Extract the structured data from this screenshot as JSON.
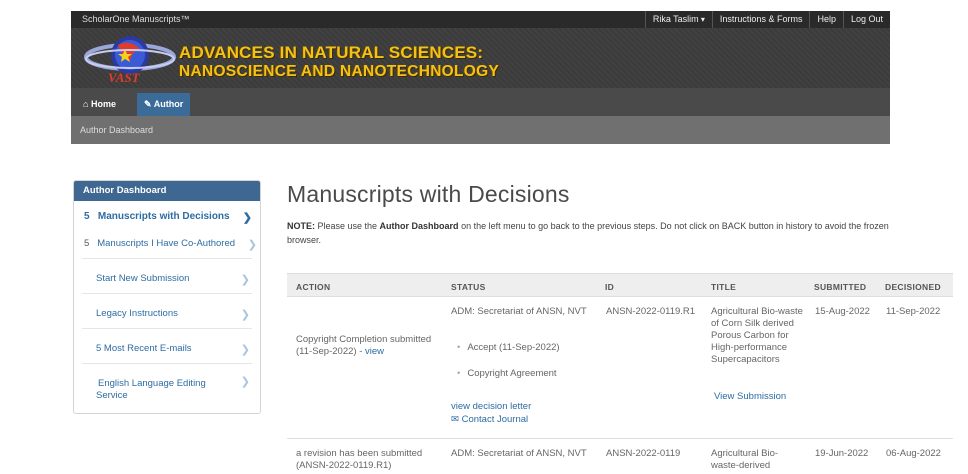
{
  "topbar": {
    "brand": "ScholarOne Manuscripts™",
    "user": "Rika Taslim",
    "instructions": "Instructions & Forms",
    "help": "Help",
    "logout": "Log Out"
  },
  "logo": {
    "text": "VAST"
  },
  "journal": {
    "line1": "ADVANCES IN NATURAL SCIENCES:",
    "line2": "NANOSCIENCE AND NANOTECHNOLOGY"
  },
  "nav": {
    "home": "Home",
    "author": "Author"
  },
  "breadcrumb": "Author Dashboard",
  "sidebar": {
    "header": "Author Dashboard",
    "items": [
      {
        "count": "5",
        "label": "Manuscripts with Decisions"
      },
      {
        "count": "5",
        "label": "Manuscripts I Have Co-Authored"
      },
      {
        "label": "Start New Submission"
      },
      {
        "label": "Legacy Instructions"
      },
      {
        "label": "5 Most Recent E-mails"
      },
      {
        "label": "English Language Editing Service"
      }
    ]
  },
  "page_title": "Manuscripts with Decisions",
  "note": {
    "prefix": "NOTE:",
    "text1": " Please use the ",
    "bold": "Author Dashboard",
    "text2": " on the left menu to go back to the previous steps. Do not click on BACK button in history to avoid the frozen browser."
  },
  "table": {
    "headers": [
      "ACTION",
      "STATUS",
      "ID",
      "TITLE",
      "SUBMITTED",
      "DECISIONED"
    ],
    "rows": [
      {
        "action": "Copyright Completion submitted (11-Sep-2022) - ",
        "action_link": "view",
        "status": "ADM: Secretariat of ANSN, NVT",
        "status_items": [
          "Accept (11-Sep-2022)",
          "Copyright Agreement"
        ],
        "decision_letter": "view decision letter",
        "contact": "Contact Journal",
        "id": "ANSN-2022-0119.R1",
        "title": "Agricultural Bio-waste of Corn Silk derived Porous Carbon for High-performance Supercapacitors",
        "view_submission": "View Submission",
        "submitted": "15-Aug-2022",
        "decisioned": "11-Sep-2022"
      },
      {
        "action": "a revision has been submitted (ANSN-2022-0119.R1)",
        "status": "ADM: Secretariat of ANSN, NVT",
        "id": "ANSN-2022-0119",
        "title": "Agricultural Bio-waste-derived",
        "submitted": "19-Jun-2022",
        "decisioned": "06-Aug-2022"
      }
    ]
  },
  "colors": {
    "accent": "#3e6791",
    "link": "#2d6ca2",
    "title_gold": "#f3c21a"
  },
  "icons": [
    "home-icon",
    "pencil-icon",
    "caret-down-icon",
    "chevron-right-icon",
    "envelope-icon"
  ]
}
